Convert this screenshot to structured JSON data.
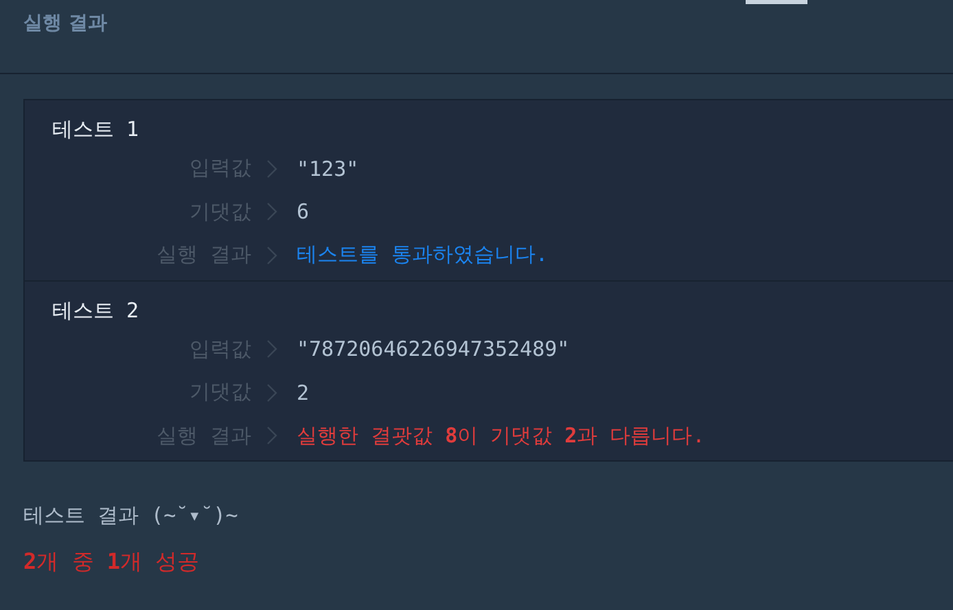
{
  "panel": {
    "title": "실행 결과"
  },
  "tests": [
    {
      "title": "테스트 1",
      "kind": "pass",
      "rows": [
        {
          "label": "입력값",
          "value": "\"123\""
        },
        {
          "label": "기댓값",
          "value": "6"
        },
        {
          "label": "실행 결과",
          "value": "테스트를 통과하였습니다."
        }
      ]
    },
    {
      "title": "테스트 2",
      "kind": "fail",
      "rows": [
        {
          "label": "입력값",
          "value": "\"78720646226947352489\""
        },
        {
          "label": "기댓값",
          "value": "2"
        },
        {
          "label": "실행 결과",
          "value": "실행한 결괏값 **8**이 기댓값 **2**과 다릅니다."
        }
      ]
    }
  ],
  "summary": {
    "title": "테스트 결과 (~˘▾˘)~",
    "result": "**2**개 중 **1**개 성공"
  }
}
